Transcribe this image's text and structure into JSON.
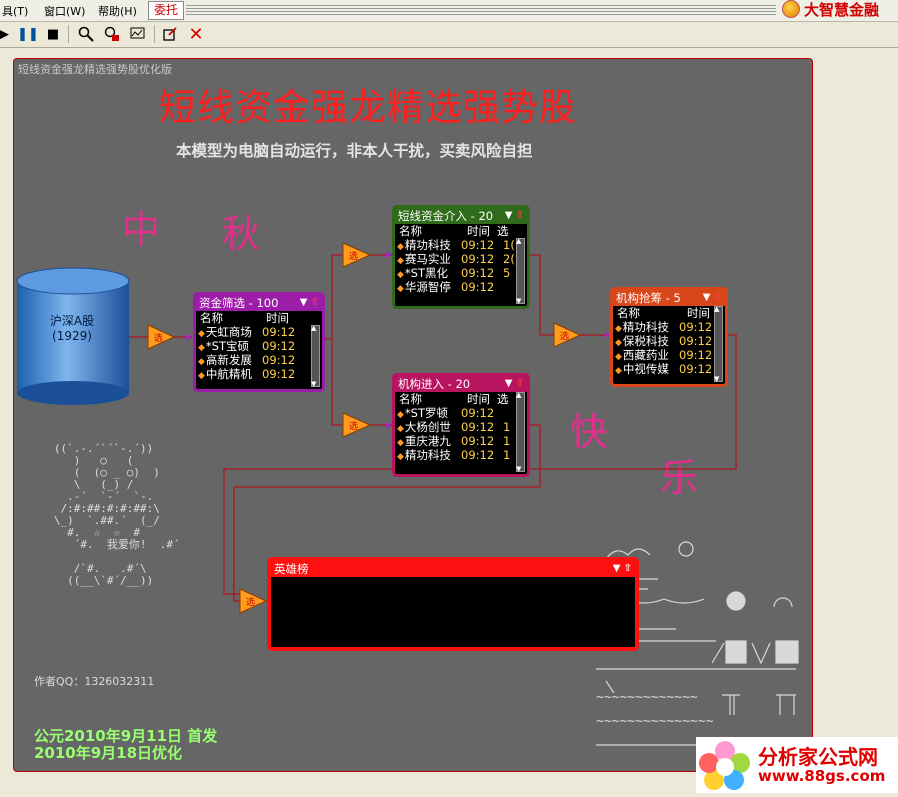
{
  "menubar": {
    "items": [
      "具(T)",
      "窗口(W)",
      "帮助(H)"
    ],
    "active_tab": "委托",
    "brand": "大智慧金融"
  },
  "toolbar": {
    "icons": [
      "play-icon",
      "pause-icon",
      "stop-icon",
      "zoom-icon",
      "lock-search-icon",
      "chart-search-icon",
      "export-icon",
      "close-icon"
    ]
  },
  "canvas": {
    "window_title": "短线资金强龙精选强势股优化版",
    "main_title": "短线资金强龙精选强势股",
    "subtitle": "本模型为电脑自动运行，非本人干扰，买卖风险自担",
    "deco_chars": [
      "中",
      "秋",
      "快",
      "乐"
    ],
    "source": {
      "label": "沪深A股",
      "count": "(1929)"
    },
    "author": "作者QQ：1326032311",
    "date_line1": "公元2010年9月11日 首发",
    "date_line2": "2010年9月18日优化",
    "ascii_text": "我爱你!"
  },
  "panels": {
    "zijin": {
      "title": "资金筛选 - 100",
      "cols": [
        "名称",
        "时间"
      ],
      "rows": [
        {
          "name": "天虹商场",
          "time": "09:12"
        },
        {
          "name": "*ST宝硕",
          "time": "09:12"
        },
        {
          "name": "高新发展",
          "time": "09:12"
        },
        {
          "name": "中航精机",
          "time": "09:12"
        }
      ]
    },
    "duanxian": {
      "title": "短线资金介入 - 20",
      "cols": [
        "名称",
        "时间",
        "选"
      ],
      "rows": [
        {
          "name": "精功科技",
          "time": "09:12",
          "x": "1("
        },
        {
          "name": "赛马实业",
          "time": "09:12",
          "x": "2("
        },
        {
          "name": "*ST黑化",
          "time": "09:12",
          "x": "5"
        },
        {
          "name": "华源智停",
          "time": "09:12",
          "x": ""
        }
      ]
    },
    "jigou_jr": {
      "title": "机构进入 - 20",
      "cols": [
        "名称",
        "时间",
        "选"
      ],
      "rows": [
        {
          "name": "*ST罗顿",
          "time": "09:12",
          "x": ""
        },
        {
          "name": "大杨创世",
          "time": "09:12",
          "x": "1"
        },
        {
          "name": "重庆港九",
          "time": "09:12",
          "x": "1"
        },
        {
          "name": "精功科技",
          "time": "09:12",
          "x": "1"
        }
      ]
    },
    "jigou_qc": {
      "title": "机构抢筹 - 5",
      "cols": [
        "名称",
        "时间"
      ],
      "rows": [
        {
          "name": "精功科技",
          "time": "09:12"
        },
        {
          "name": "保税科技",
          "time": "09:12"
        },
        {
          "name": "西藏药业",
          "time": "09:12"
        },
        {
          "name": "中视传媒",
          "time": "09:12"
        }
      ]
    },
    "yingxiong": {
      "title": "英雄榜"
    }
  },
  "site_logo": {
    "name": "分析家公式网",
    "url": "www.88gs.com"
  },
  "colors": {
    "canvas_bg": "#666666",
    "title_red": "#ff1e1e",
    "deco_pink": "#e0308c",
    "purple": "#9c1ea8",
    "green": "#2f6b1a",
    "crimson": "#b81460",
    "orange": "#d8461a",
    "hero_red": "#ff1010"
  }
}
